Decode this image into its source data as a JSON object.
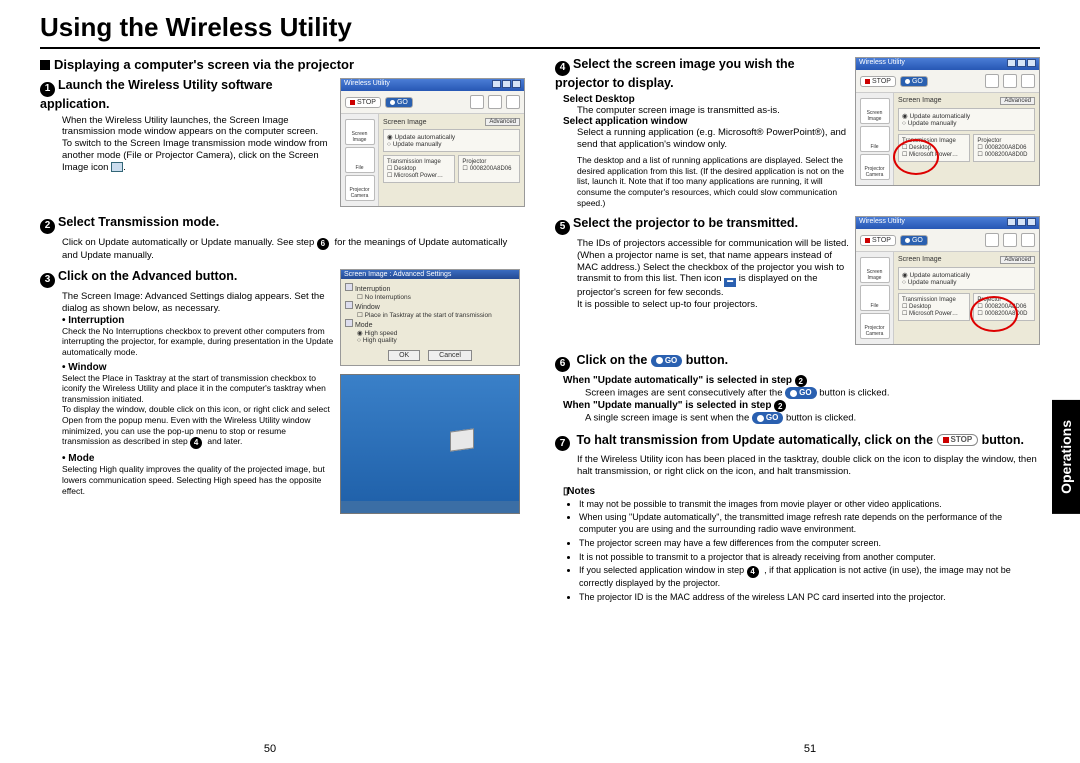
{
  "title": "Using the Wireless Utility",
  "side_tab": "Operations",
  "page_left": "50",
  "page_right": "51",
  "section_heading": "Displaying a computer's screen via the projector",
  "steps": {
    "s1": {
      "num": "1",
      "head": "Launch the Wireless Utility software application.",
      "body": "When the Wireless Utility launches, the Screen Image transmission mode window appears on the computer screen.",
      "body2": "To switch to the Screen Image transmission mode window from another mode (File or Projector Camera), click on the Screen Image icon",
      "body2_end": "."
    },
    "s2": {
      "num": "2",
      "head": "Select Transmission mode.",
      "body": "Click on Update automatically or Update manually. See step",
      "body_step": "6",
      "body_end": "for the meanings of Update automatically and Update manually."
    },
    "s3": {
      "num": "3",
      "head": "Click on the Advanced button.",
      "body": "The Screen Image: Advanced Settings dialog appears. Set the dialog as shown below, as necessary.",
      "b1_label": "Interruption",
      "b1_body": "Check the No Interruptions checkbox to prevent other computers from interrupting the projector, for example, during presentation in the Update automatically mode.",
      "b2_label": "Window",
      "b2_body": "Select the Place in Tasktray at the start of transmission checkbox to iconify the Wireless Utility and place it in the computer's tasktray when transmission initiated.",
      "b2_body2": "To display the window, double click on this icon, or right click and select Open from the popup menu. Even with the Wireless Utility window minimized, you can use the pop-up menu to stop or resume transmission as described in step",
      "b2_step": "4",
      "b2_end": "and later.",
      "b3_label": "Mode",
      "b3_body": "Selecting High quality improves the quality of the projected image, but lowers communication speed. Selecting High speed has the opposite effect."
    },
    "s4": {
      "num": "4",
      "head": "Select the screen image you wish the projector to display.",
      "sub1_label": "Select Desktop",
      "sub1_body": "The computer screen image is transmitted as-is.",
      "sub2_label": "Select application window",
      "sub2_body": "Select a running application (e.g. Microsoft® PowerPoint®), and send that application's window only.",
      "fine": "The desktop and a list of running applications are displayed. Select the desired application from this list. (If the desired application is not on the list, launch it. Note that if too many applications are running, it will consume the computer's resources, which could slow communication speed.)"
    },
    "s5": {
      "num": "5",
      "head": "Select the projector to be transmitted.",
      "body": "The IDs of projectors accessible for communication will be listed. (When a projector name is set, that name appears instead of MAC address.) Select the checkbox of the projector you wish to transmit to from this list. Then icon",
      "body_end": "is displayed on the projector's screen for few seconds.",
      "body2": "It is possible to select up-to four projectors."
    },
    "s6": {
      "num": "6",
      "head_pre": "Click on the",
      "head_post": "button.",
      "sub1_label": "When \"Update automatically\" is selected in step",
      "sub1_step": "2",
      "sub1_body": "Screen images are sent consecutively after the",
      "sub1_end": "button is clicked.",
      "sub2_label": "When \"Update manually\" is selected in step",
      "sub2_step": "2",
      "sub2_body": "A single screen image is sent when the",
      "sub2_end": "button is clicked."
    },
    "s7": {
      "num": "7",
      "head_pre": "To halt transmission from Update automatically, click on the",
      "head_post": "button.",
      "body": "If the Wireless Utility icon has been placed in the tasktray, double click on the icon to display the window, then halt transmission, or right click on the icon, and halt transmission."
    }
  },
  "notes": {
    "heading": "Notes",
    "n1": "It may not be possible to transmit the images from movie player or other video applications.",
    "n2_pre": "When using \"Update automatically\", the transmitted image refresh rate depends on the performance of the computer you are using and the surrounding radio wave environment.",
    "n3": "The projector screen may have a few differences from the computer screen.",
    "n4": "It is not possible to transmit to a projector that is already receiving from another computer.",
    "n5_pre": "If you selected application window in step",
    "n5_step": "4",
    "n5_post": ", if that application is not active (in use), the image may not be correctly displayed by the projector.",
    "n6": "The projector ID is the MAC address of the wireless LAN PC card inserted into the projector."
  },
  "shots": {
    "win_title": "Wireless Utility",
    "stop": "STOP",
    "go": "GO",
    "screen_image": "Screen Image",
    "advanced": "Advanced",
    "trans_image": "Transmission Image",
    "projector": "Projector",
    "update_auto": "Update automatically",
    "update_manual": "Update manually",
    "desktop": "Desktop",
    "ms_power": "Microsoft Power…",
    "mac1": "0008200A8D06",
    "mac2": "0008200A8D0D",
    "side_screen": "Screen Image",
    "side_file": "File",
    "side_cam": "Projector Camera",
    "adv_title": "Screen Image : Advanced Settings",
    "adv_interruption": "Interruption",
    "adv_noint": "No Interruptions",
    "adv_window": "Window",
    "adv_place": "Place in Tasktray at the start of transmission",
    "adv_mode": "Mode",
    "adv_hs": "High speed",
    "adv_hq": "High quality",
    "ok": "OK",
    "cancel": "Cancel"
  }
}
